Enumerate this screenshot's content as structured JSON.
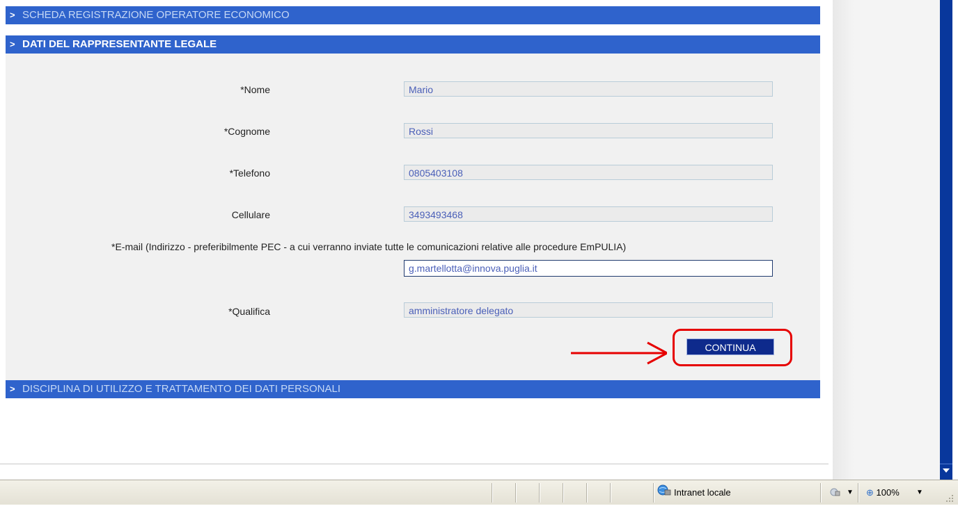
{
  "sections": {
    "scheda": "SCHEDA REGISTRAZIONE OPERATORE ECONOMICO",
    "dati": "DATI DEL RAPPRESENTANTE LEGALE",
    "disciplina": "DISCIPLINA DI UTILIZZO E TRATTAMENTO DEI DATI PERSONALI"
  },
  "form": {
    "nome": {
      "label": "*Nome",
      "value": "Mario"
    },
    "cognome": {
      "label": "*Cognome",
      "value": "Rossi"
    },
    "telefono": {
      "label": "*Telefono",
      "value": "0805403108"
    },
    "cellulare": {
      "label": "Cellulare",
      "value": "3493493468"
    },
    "email": {
      "label": "*E-mail (Indirizzo - preferibilmente PEC - a cui verranno inviate tutte le comunicazioni relative alle procedure EmPULIA)",
      "value": "g.martellotta@innova.puglia.it"
    },
    "qualifica": {
      "label": "*Qualifica",
      "value": "amministratore delegato"
    }
  },
  "continue_label": "CONTINUA",
  "statusbar": {
    "zone": "Intranet locale",
    "zoom": "100%"
  },
  "colors": {
    "section_bar": "#2f63cc",
    "button": "#0e2a8c",
    "highlight": "#e60000",
    "scrollbar": "#08379c"
  }
}
